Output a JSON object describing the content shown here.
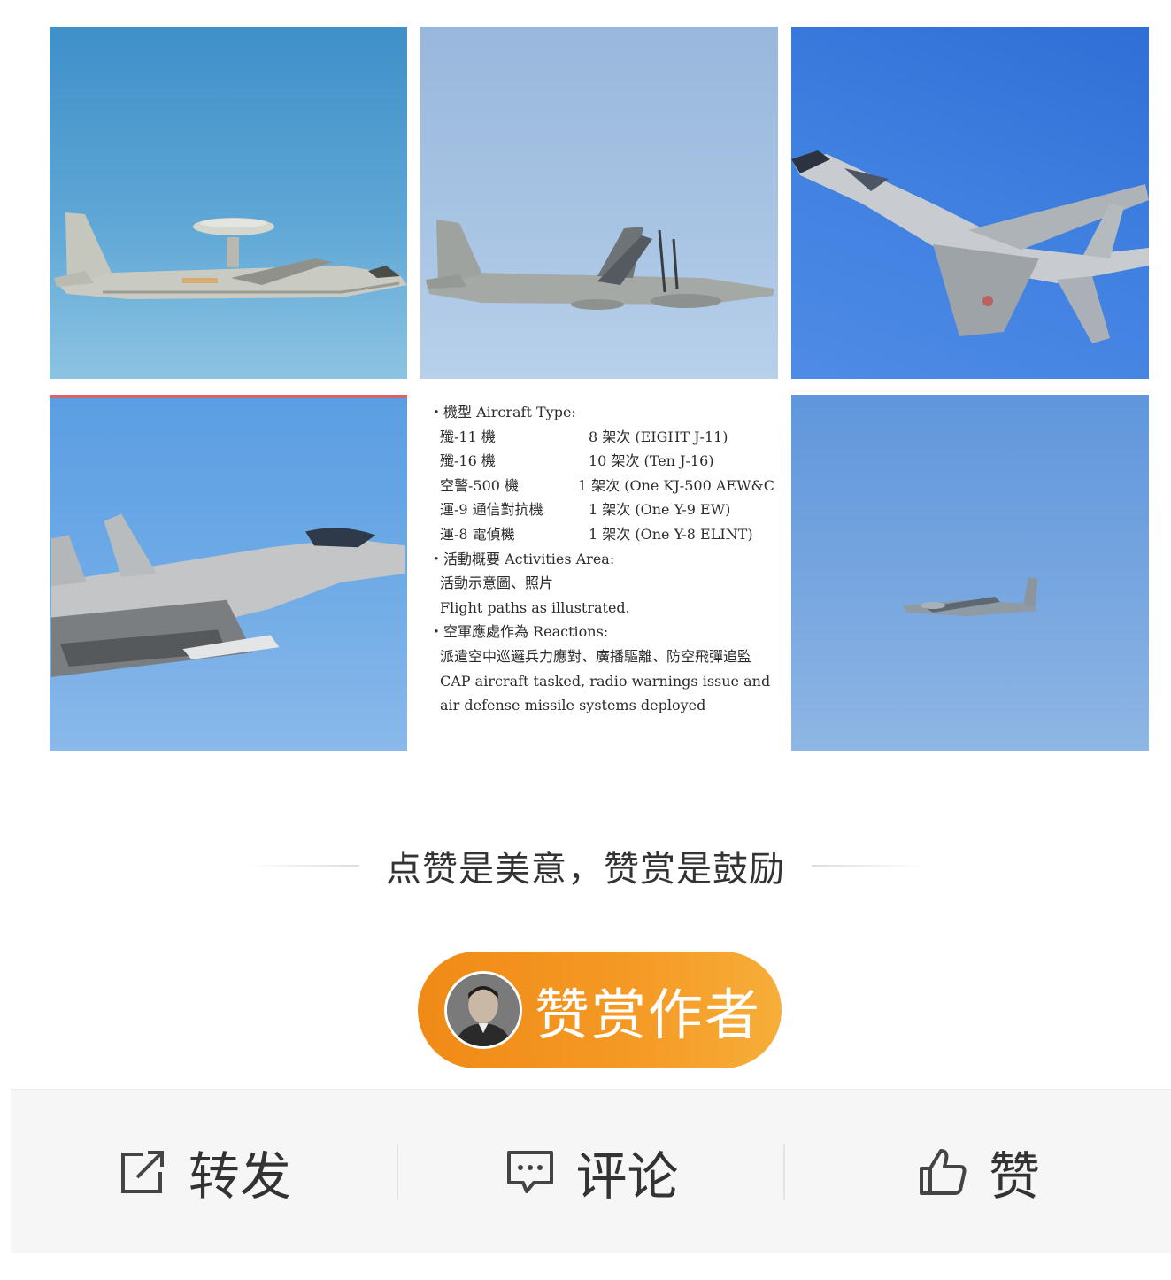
{
  "doc_card": {
    "heading_type": "‧機型 Aircraft Type:",
    "aircraft": [
      {
        "name": "殲-11 機",
        "count": "8 架次 (EIGHT J-11)"
      },
      {
        "name": "殲-16 機",
        "count": "10 架次 (Ten J-16)"
      },
      {
        "name": "空警-500 機",
        "count": "1 架次 (One KJ-500 AEW&C"
      },
      {
        "name": "運-9 通信對抗機",
        "count": "1 架次 (One Y-9 EW)"
      },
      {
        "name": "運-8 電偵機",
        "count": "1 架次 (One Y-8 ELINT)"
      }
    ],
    "heading_area": "‧活動概要 Activities Area:",
    "area_cn": "活動示意圖、照片",
    "area_en": "Flight paths as illustrated.",
    "heading_reactions": "‧空軍應處作為 Reactions:",
    "reactions_cn": "派遣空中巡邏兵力應對、廣播驅離、防空飛彈追監",
    "reactions_en": "CAP aircraft tasked, radio warnings issue and air defense missile systems deployed"
  },
  "praise": {
    "text": "点赞是美意，赞赏是鼓励"
  },
  "reward_button": {
    "label": "赞赏作者"
  },
  "actions": {
    "share": "转发",
    "comment": "评论",
    "like": "赞"
  },
  "colors": {
    "reward_button": "#f59a25",
    "action_bar_bg": "#f6f6f6",
    "text": "#333333"
  },
  "icons": {
    "share": "share-icon",
    "comment": "comment-icon",
    "like": "thumbs-up-icon"
  }
}
